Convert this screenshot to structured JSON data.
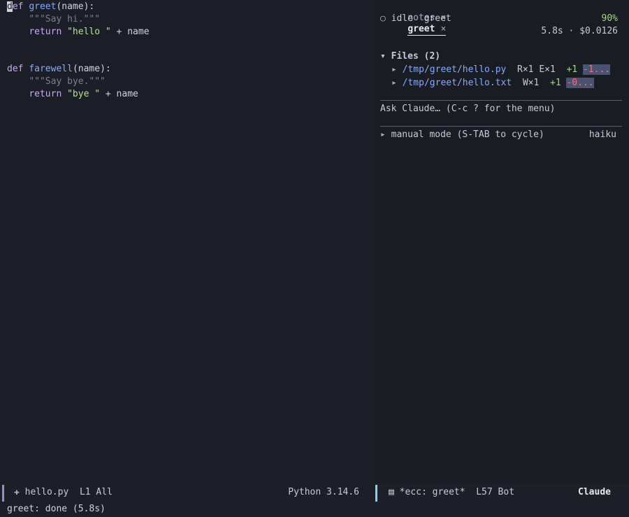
{
  "editor": {
    "lines": [
      {
        "indent": "",
        "kw": "def ",
        "fn": "greet",
        "rest": "(name):",
        "cursor_char": "d"
      },
      {
        "indent": "    ",
        "doc": "\"\"\"Say hi.\"\"\""
      },
      {
        "indent": "    ",
        "kw": "return ",
        "str": "\"hello \"",
        "rest": " + name"
      },
      {
        "indent": "",
        "kw": "def ",
        "fn": "farewell",
        "rest": "(name):"
      },
      {
        "indent": "    ",
        "doc": "\"\"\"Say bye.\"\"\""
      },
      {
        "indent": "    ",
        "kw": "return ",
        "str": "\"bye \"",
        "rest": " + name"
      }
    ]
  },
  "claude_panel": {
    "tabs": [
      {
        "label": "notes",
        "close": "×",
        "active": false
      },
      {
        "label": "greet",
        "close": "×",
        "active": true
      }
    ],
    "status_icon": "○",
    "status": "idle",
    "session": "greet",
    "context_pct": "90%",
    "stats": "5.8s · $0.0126",
    "files_header": "Files (2)",
    "files_toggle": "▾",
    "files": [
      {
        "arrow": "▸",
        "path": "/tmp/greet/hello.py",
        "ops": "R×1 E×1",
        "added": "+1",
        "removed": "-1..."
      },
      {
        "arrow": "▸",
        "path": "/tmp/greet/hello.txt",
        "ops": "W×1",
        "added": "+1",
        "removed": "-0..."
      }
    ],
    "prompt_placeholder": "Ask Claude… (C-c ? for the menu)",
    "mode_arrow": "▸",
    "mode": "manual mode (S-TAB to cycle)",
    "model": "haiku"
  },
  "modeline_left": {
    "buffer": "hello.py",
    "position": "L1 All",
    "mode": "Python 3.14.6",
    "accent": "#8b93c9"
  },
  "modeline_right": {
    "buffer": "*ecc: greet*",
    "position": "L57 Bot",
    "mode": "Claude",
    "accent": "#7fd4e8"
  },
  "echo_area": "greet: done (5.8s)"
}
